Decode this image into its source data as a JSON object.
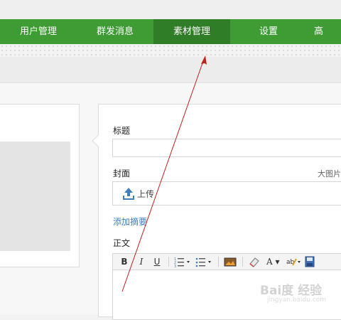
{
  "nav": {
    "items": [
      {
        "label": "用户管理"
      },
      {
        "label": "群发消息"
      },
      {
        "label": "素材管理",
        "active": true
      },
      {
        "label": "设置"
      },
      {
        "label": "高"
      }
    ],
    "color": "#3f9c35",
    "active_color": "#2f7d27"
  },
  "editor": {
    "title_label": "标题",
    "title_value": "",
    "cover_label": "封面",
    "cover_hint": "大图片",
    "upload_label": "上传",
    "add_summary_link": "添加摘要",
    "body_label": "正文"
  },
  "toolbar": {
    "bold": "B",
    "italic": "I",
    "underline": "U",
    "font_color": "A",
    "icons": [
      "bold-icon",
      "italic-icon",
      "underline-icon",
      "ordered-list-icon",
      "unordered-list-icon",
      "image-icon",
      "eraser-icon",
      "font-color-icon",
      "highlight-icon",
      "save-icon"
    ]
  },
  "watermark": {
    "text": "Bai度 经验",
    "url": "jingyan.baidu.com"
  }
}
